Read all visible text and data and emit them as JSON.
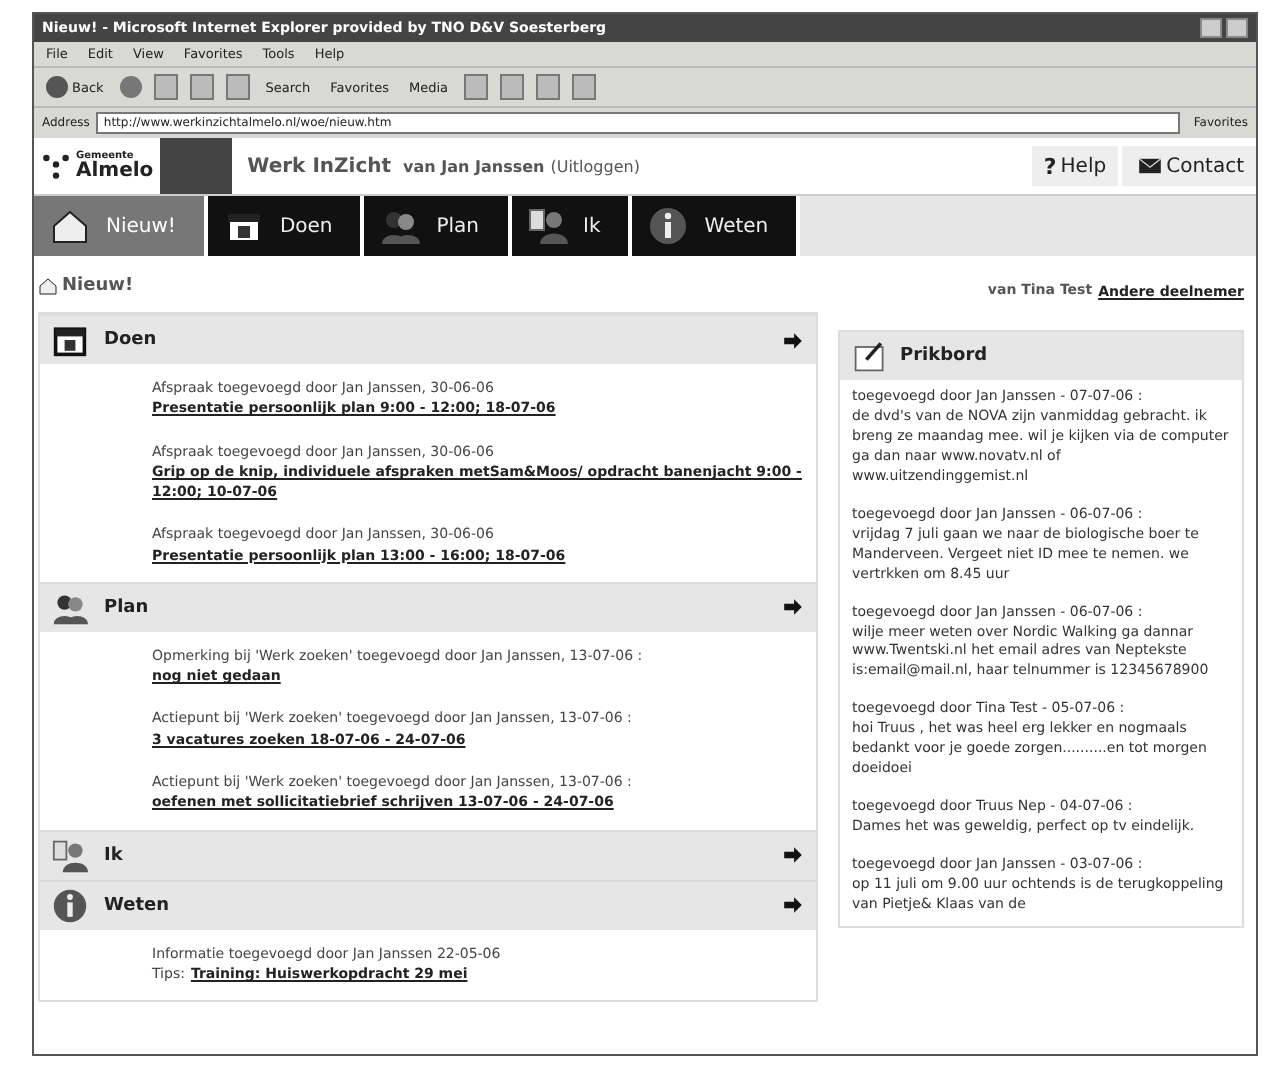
{
  "window": {
    "title": "Nieuw! - Microsoft Internet Explorer provided by TNO D&V Soesterberg"
  },
  "menu": [
    "File",
    "Edit",
    "View",
    "Favorites",
    "Tools",
    "Help"
  ],
  "toolbar": {
    "back": "Back",
    "search": "Search",
    "favorites": "Favorites",
    "media": "Media"
  },
  "address": {
    "label": "Address",
    "value": "http://www.werkinzichtalmelo.nl/woe/nieuw.htm",
    "links": "Favorites"
  },
  "header": {
    "logo_small": "Gemeente",
    "logo": "Almelo",
    "app_title": "Werk InZicht",
    "user": "van Jan Janssen",
    "logout": "(Uitloggen)",
    "help": "Help",
    "help_glyph": "?",
    "contact": "Contact"
  },
  "tabs": [
    {
      "label": "Nieuw!",
      "kind": "nieuw",
      "selected": true
    },
    {
      "label": "Doen",
      "kind": "doen",
      "selected": false
    },
    {
      "label": "Plan",
      "kind": "plan",
      "selected": false
    },
    {
      "label": "Ik",
      "kind": "ik",
      "selected": false
    },
    {
      "label": "Weten",
      "kind": "weten",
      "selected": false
    }
  ],
  "page": {
    "heading": "Nieuw!",
    "viewer": "van Tina Test",
    "other_link": "Andere deelnemer"
  },
  "sections": [
    {
      "title": "Doen",
      "kind": "doen",
      "items": [
        {
          "meta": "Afspraak toegevoegd door Jan Janssen, 30-06-06",
          "link": "Presentatie persoonlijk plan 9:00 - 12:00; 18-07-06"
        },
        {
          "meta": "Afspraak toegevoegd door Jan Janssen, 30-06-06",
          "link": "Grip op de knip, individuele afspraken metSam&Moos/ opdracht banenjacht 9:00 - 12:00; 10-07-06"
        },
        {
          "meta": "Afspraak toegevoegd door Jan Janssen, 30-06-06",
          "link": "Presentatie persoonlijk plan 13:00 - 16:00; 18-07-06"
        }
      ]
    },
    {
      "title": "Plan",
      "kind": "plan",
      "items": [
        {
          "meta": "Opmerking bij 'Werk zoeken' toegevoegd door Jan Janssen, 13-07-06 :",
          "link": "nog niet gedaan"
        },
        {
          "meta": "Actiepunt bij 'Werk zoeken' toegevoegd door Jan Janssen, 13-07-06 :",
          "link": "3 vacatures zoeken 18-07-06 - 24-07-06"
        },
        {
          "meta": "Actiepunt bij 'Werk zoeken' toegevoegd door Jan Janssen, 13-07-06 :",
          "link": "oefenen met sollicitatiebrief schrijven 13-07-06 - 24-07-06"
        }
      ]
    },
    {
      "title": "Ik",
      "kind": "ik"
    },
    {
      "title": "Weten",
      "kind": "weten",
      "items": [
        {
          "meta": "Informatie toegevoegd door Jan Janssen 22-05-06",
          "prefix": "Tips:",
          "link": "Training: Huiswerkopdracht 29 mei"
        }
      ]
    }
  ],
  "prikbord": {
    "title": "Prikbord",
    "posts": [
      {
        "meta": "toegevoegd door Jan Janssen - 07-07-06 :",
        "text": "de dvd's van de NOVA zijn vanmiddag gebracht. ik breng ze maandag mee. wil je kijken via de computer ga dan naar www.novatv.nl of www.uitzendinggemist.nl"
      },
      {
        "meta": "toegevoegd door Jan Janssen - 06-07-06 :",
        "text": "vrijdag 7 juli gaan we naar de biologische boer te Manderveen. Vergeet niet ID mee te nemen. we vertrkken om 8.45 uur"
      },
      {
        "meta": "toegevoegd door Jan Janssen - 06-07-06 :",
        "text": "wilje meer weten over Nordic Walking ga dannar www.Twentski.nl het email adres van Neptekste is:email@mail.nl, haar telnummer is 12345678900"
      },
      {
        "meta": "toegevoegd door Tina Test - 05-07-06 :",
        "text": "hoi Truus , het was heel erg lekker en nogmaals bedankt voor je goede zorgen..........en tot morgen doeidoei"
      },
      {
        "meta": "toegevoegd door Truus Nep - 04-07-06 :",
        "text": "Dames het was geweldig, perfect op tv eindelijk."
      },
      {
        "meta": "toegevoegd door Jan Janssen - 03-07-06 :",
        "text": "op 11 juli om 9.00 uur ochtends is de terugkoppeling van Pietje& Klaas van de"
      }
    ]
  }
}
